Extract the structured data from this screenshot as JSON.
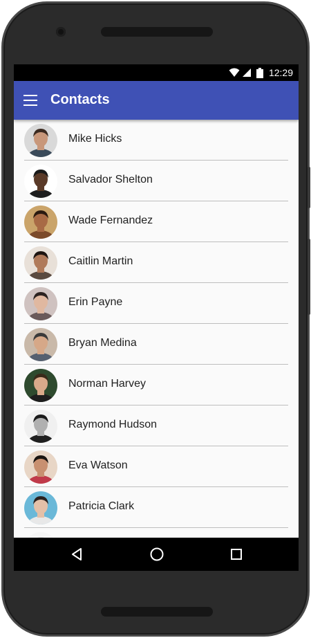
{
  "status_bar": {
    "time": "12:29",
    "icons": [
      "wifi-icon",
      "signal-icon",
      "battery-icon"
    ]
  },
  "app_bar": {
    "title": "Contacts",
    "color": "#3f51b5",
    "menu_icon": "menu-icon"
  },
  "contacts": [
    {
      "name": "Mike Hicks",
      "skin": "#c8977a",
      "hair": "#3b2a20",
      "bg": "#d9d9d9",
      "shirt": "#3a4a5a"
    },
    {
      "name": "Salvador Shelton",
      "skin": "#5a3a28",
      "hair": "#1a1a1a",
      "bg": "#ffffff",
      "shirt": "#1e1e1e"
    },
    {
      "name": "Wade Fernandez",
      "skin": "#a86a45",
      "hair": "#2a1a10",
      "bg": "#caa46a",
      "shirt": "#7b4a2a"
    },
    {
      "name": "Caitlin Martin",
      "skin": "#b07a5a",
      "hair": "#1d1410",
      "bg": "#e8e0d8",
      "shirt": "#5a4a40"
    },
    {
      "name": "Erin Payne",
      "skin": "#e0b8a0",
      "hair": "#2b2220",
      "bg": "#cfc2c0",
      "shirt": "#6a5a5a"
    },
    {
      "name": "Bryan Medina",
      "skin": "#d6a888",
      "hair": "#3a3a3a",
      "bg": "#c9b9a9",
      "shirt": "#556070"
    },
    {
      "name": "Norman Harvey",
      "skin": "#d9a98a",
      "hair": "#3a2a1a",
      "bg": "#2e4a2e",
      "shirt": "#1e1e1e"
    },
    {
      "name": "Raymond Hudson",
      "skin": "#b0b0b0",
      "hair": "#1a1a1a",
      "bg": "#f0f0f0",
      "shirt": "#202020"
    },
    {
      "name": "Eva Watson",
      "skin": "#c89070",
      "hair": "#1a1410",
      "bg": "#e8d6c6",
      "shirt": "#c03a4a"
    },
    {
      "name": "Patricia Clark",
      "skin": "#e4c0a8",
      "hair": "#2a2220",
      "bg": "#6ab8d8",
      "shirt": "#e8e8e8"
    },
    {
      "name": "",
      "skin": "#eeeeee",
      "hair": "#e0e0e0",
      "bg": "#f5f5f5",
      "shirt": "#eeeeee"
    }
  ],
  "nav_bar": {
    "buttons": [
      "back-icon",
      "home-icon",
      "recents-icon"
    ]
  }
}
